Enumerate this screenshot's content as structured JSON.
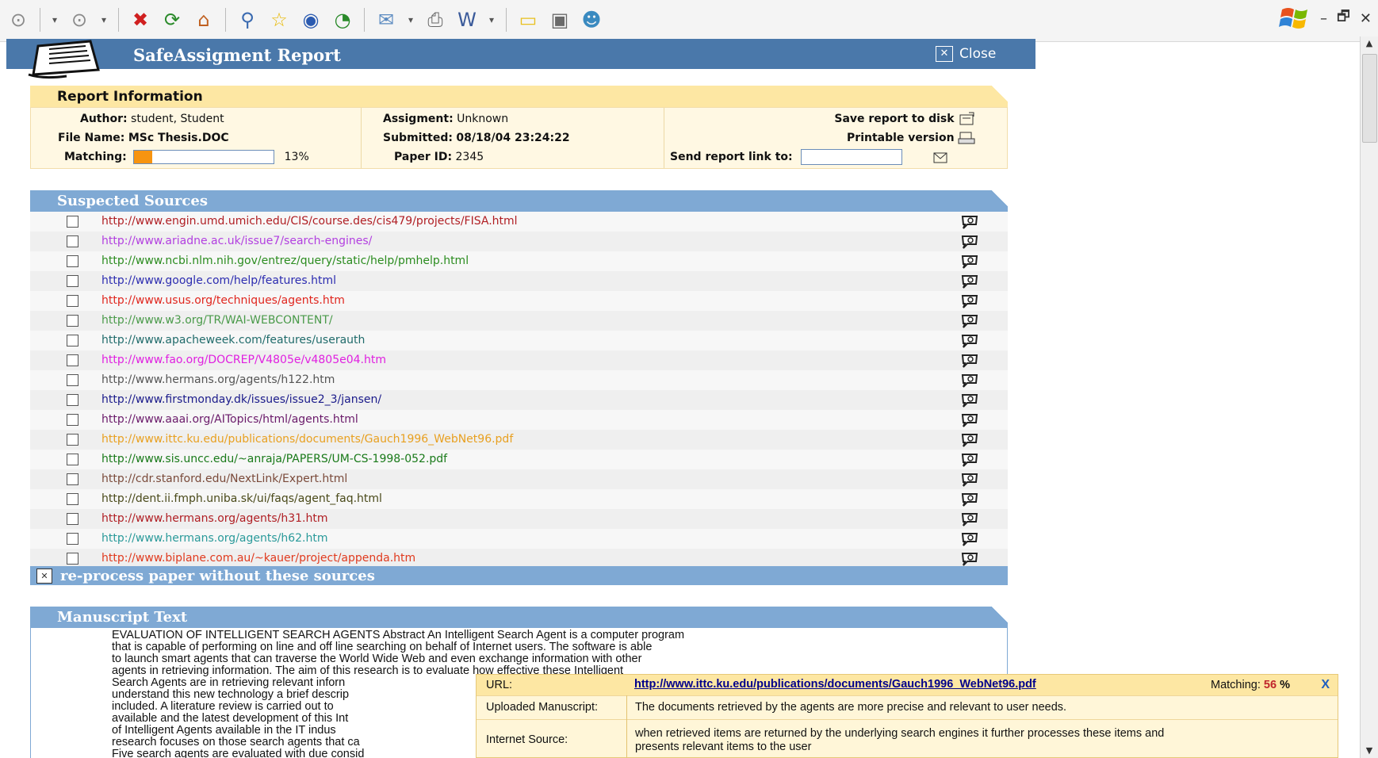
{
  "toolbar": {
    "buttons": [
      "back-icon",
      "dropdown-arrow-icon",
      "forward-icon",
      "dropdown-arrow-icon",
      "stop-icon",
      "refresh-icon",
      "home-icon",
      "search-icon",
      "favorites-icon",
      "media-icon",
      "history-icon",
      "mail-icon",
      "dropdown-arrow-icon",
      "print-icon",
      "edit-icon",
      "dropdown-arrow-icon",
      "notes-icon",
      "research-icon",
      "messenger-icon"
    ],
    "window_controls": {
      "minimize": "–",
      "restore": "🗗",
      "close": "✕"
    }
  },
  "report": {
    "title": "SafeAssigment Report",
    "close_label": "Close"
  },
  "report_info": {
    "heading": "Report Information",
    "author_label": "Author:",
    "author": "student, Student",
    "file_label": "File Name:",
    "file": "MSc Thesis.DOC",
    "matching_label": "Matching:",
    "matching_value": "13%",
    "matching_fraction": 0.13,
    "assignment_label": "Assigment:",
    "assignment": "Unknown",
    "submitted_label": "Submitted:",
    "submitted": "08/18/04 23:24:22",
    "paper_label": "Paper ID:",
    "paper_id": "2345",
    "save_label": "Save report to disk",
    "printable_label": "Printable version",
    "send_label": "Send report link to:"
  },
  "suspected": {
    "heading": "Suspected Sources",
    "sources": [
      {
        "url": "http://www.engin.umd.umich.edu/CIS/course.des/cis479/projects/FISA.html",
        "color": "#b01e23"
      },
      {
        "url": "http://www.ariadne.ac.uk/issue7/search-engines/",
        "color": "#b23fe0"
      },
      {
        "url": "http://www.ncbi.nlm.nih.gov/entrez/query/static/help/pmhelp.html",
        "color": "#2b8c1f"
      },
      {
        "url": "http://www.google.com/help/features.html",
        "color": "#2c2cb0"
      },
      {
        "url": "http://www.usus.org/techniques/agents.htm",
        "color": "#e0261e"
      },
      {
        "url": "http://www.w3.org/TR/WAI-WEBCONTENT/",
        "color": "#4a9a4a"
      },
      {
        "url": "http://www.apacheweek.com/features/userauth",
        "color": "#206b6b"
      },
      {
        "url": "http://www.fao.org/DOCREP/V4805e/v4805e04.htm",
        "color": "#e020e0"
      },
      {
        "url": "http://www.hermans.org/agents/h122.htm",
        "color": "#555555"
      },
      {
        "url": "http://www.firstmonday.dk/issues/issue2_3/jansen/",
        "color": "#1a1a8a"
      },
      {
        "url": "http://www.aaai.org/AITopics/html/agents.html",
        "color": "#6a1a6a"
      },
      {
        "url": "http://www.ittc.ku.edu/publications/documents/Gauch1996_WebNet96.pdf",
        "color": "#e8a020"
      },
      {
        "url": "http://www.sis.uncc.edu/~anraja/PAPERS/UM-CS-1998-052.pdf",
        "color": "#1a7a1a"
      },
      {
        "url": "http://cdr.stanford.edu/NextLink/Expert.html",
        "color": "#7a4a3a"
      },
      {
        "url": "http://dent.ii.fmph.uniba.sk/ui/faqs/agent_faq.html",
        "color": "#4a4a1a"
      },
      {
        "url": "http://www.hermans.org/agents/h31.htm",
        "color": "#b01e23"
      },
      {
        "url": "http://www.hermans.org/agents/h62.htm",
        "color": "#2a9a9a"
      },
      {
        "url": "http://www.biplane.com.au/~kauer/project/appenda.htm",
        "color": "#e03a1e"
      }
    ],
    "reprocess_label": "re-process paper without these sources"
  },
  "manuscript": {
    "heading": "Manuscript Text",
    "lines": [
      "EVALUATION OF INTELLIGENT SEARCH AGENTS Abstract An Intelligent Search Agent is a computer program",
      "that is capable of performing on line and off line searching on behalf of Internet users. The software is able",
      "to launch smart agents that can traverse the World Wide Web and even exchange information with other",
      "agents in retrieving information. The aim of this research is to evaluate how effective these Intelligent",
      "Search Agents are in retrieving relevant inforn",
      "understand this new technology a brief descrip",
      "included. A literature review is carried out to",
      "available and the latest development of this Int",
      "of Intelligent Agents available in the IT indus",
      "research focuses on those search agents that ca",
      "Five search agents are evaluated with due consid"
    ]
  },
  "popup": {
    "url_label": "URL:",
    "url": "http://www.ittc.ku.edu/publications/documents/Gauch1996_WebNet96.pdf",
    "matching_label": "Matching:",
    "matching_value": "56",
    "matching_unit": "%",
    "close": "X",
    "uploaded_label": "Uploaded Manuscript:",
    "uploaded_text": "The documents retrieved by the agents are more precise and relevant to user needs.",
    "internet_label": "Internet Source:",
    "internet_line1": "when retrieved items are returned by the underlying search engines it further processes these items and",
    "internet_line2": "presents relevant items to the user"
  }
}
